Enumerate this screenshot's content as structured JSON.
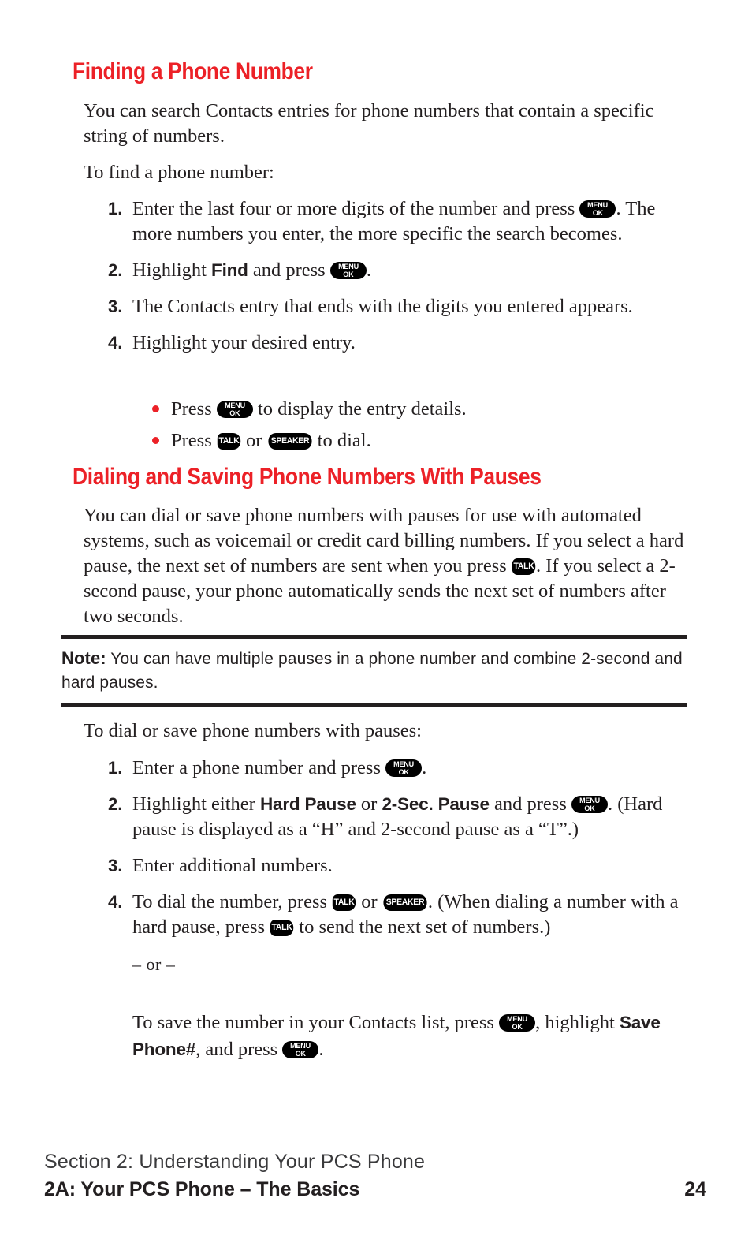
{
  "page": {
    "number": "24",
    "background": "#ffffff",
    "accent_red": "#ec2127",
    "text_color": "#231f20"
  },
  "headings": {
    "finding": "Finding a Phone Number",
    "dialing": "Dialing and Saving Phone Numbers With Pauses"
  },
  "finding_section": {
    "intro": "You can search Contacts entries for phone numbers that contain a specific string of numbers.",
    "lead_in": "To find a phone number:",
    "steps": [
      {
        "number": "1.",
        "part1": "Enter the last four or more digits of the number and press",
        "key": "menu-ok",
        "part2": ". The more numbers you enter, the more specific the search becomes."
      },
      {
        "number": "2.",
        "part1": "Highlight",
        "bold": "Find",
        "part2": "and press",
        "key": "menu-ok",
        "part3": "."
      },
      {
        "number": "3.",
        "part1": "The Contacts entry that ends with the digits you entered appears."
      },
      {
        "number": "4.",
        "part1": "Highlight your desired entry."
      }
    ],
    "bullets": [
      {
        "part1": "Press",
        "key": "menu-ok",
        "part2": "to display the entry details."
      },
      {
        "part1": "Press",
        "key1": "talk",
        "mid": "or",
        "key2": "speaker",
        "part2": "to dial."
      }
    ]
  },
  "dialing_section": {
    "intro_part1": "You can dial or save phone numbers with pauses for use with automated systems, such as voicemail or credit card billing numbers. If you select a hard pause, the next set of numbers are sent when you press",
    "intro_key": "talk",
    "intro_part2": ". If you select a 2-second pause, your phone automatically sends the next set of numbers after two seconds.",
    "note": {
      "label": "Note:",
      "text": "You can have multiple pauses in a phone number and combine 2-second and hard pauses."
    },
    "lead_in": "To dial or save phone numbers with pauses:",
    "steps": [
      {
        "number": "1.",
        "part1": "Enter a phone number and press",
        "key": "menu-ok",
        "part2": "."
      },
      {
        "number": "2.",
        "part1": "Highlight either",
        "bold1": "Hard Pause",
        "mid": "or",
        "bold2": "2-Sec. Pause",
        "part2": "and press",
        "key": "menu-ok",
        "part3": ". (Hard pause is displayed as a “H” and 2-second pause as a “T”.)"
      },
      {
        "number": "3.",
        "part1": "Enter additional numbers."
      },
      {
        "number": "4.",
        "part1": "To dial the number, press",
        "key1": "talk",
        "mid": "or",
        "key2": "speaker",
        "part2": ". (When dialing a number with a hard pause, press",
        "key3": "talk",
        "part3": "to send the next set of numbers.)"
      }
    ],
    "or_separator": "– or –",
    "save_part1": "To save the number in your Contacts list, press",
    "save_key1": "menu-ok",
    "save_part2": ", highlight",
    "save_bold": "Save Phone#",
    "save_part3": ", and press",
    "save_key2": "menu-ok",
    "save_part4": "."
  },
  "keys": {
    "menu_ok": {
      "top": "MENU",
      "bottom": "OK"
    },
    "talk": "TALK",
    "speaker": "SPEAKER"
  },
  "footer": {
    "section_line": "Section 2: Understanding Your PCS Phone",
    "chapter_line": "2A: Your PCS Phone – The Basics",
    "page_number": "24"
  }
}
